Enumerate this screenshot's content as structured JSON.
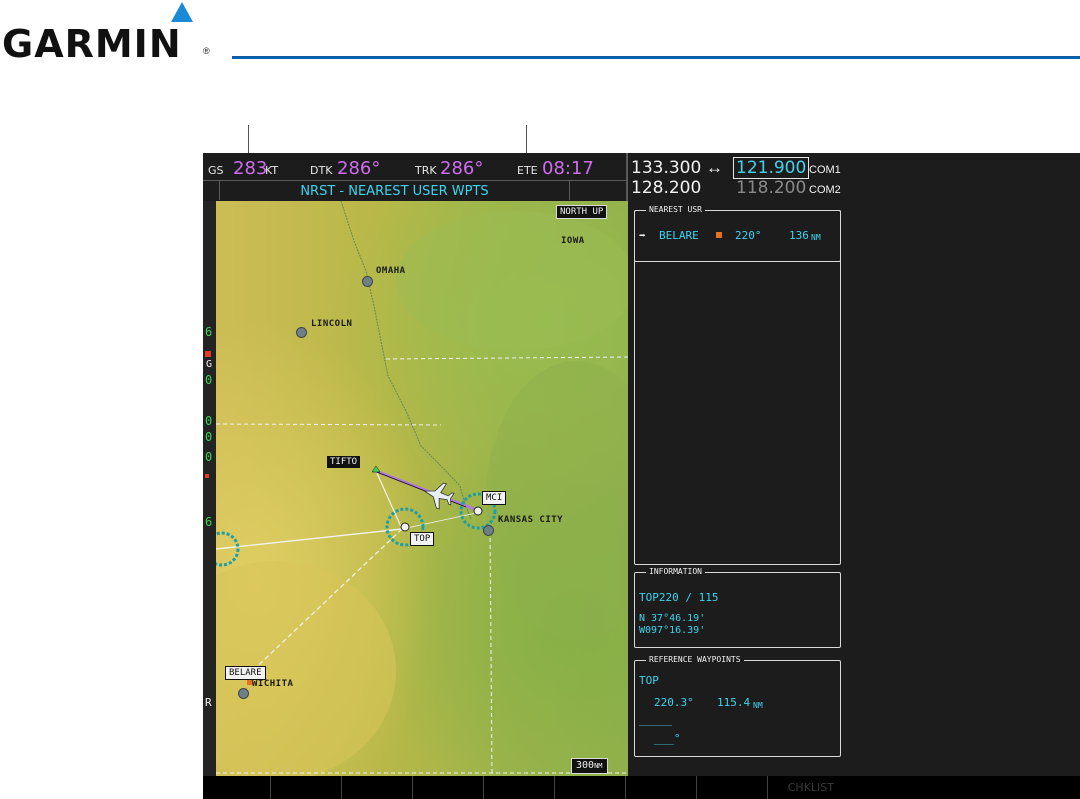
{
  "brand": {
    "name": "GARMIN",
    "registered_mark": "®"
  },
  "nav_bar": {
    "gs_label": "GS",
    "gs_value": "283",
    "gs_unit": "KT",
    "dtk_label": "DTK",
    "dtk_value": "286°",
    "trk_label": "TRK",
    "trk_value": "286°",
    "ete_label": "ETE",
    "ete_value": "08:17",
    "page_title": "NRST - NEAREST USER WPTS"
  },
  "radios": {
    "com1_active": "133.300",
    "com1_swap": "↔",
    "com1_standby": "121.900",
    "com1_label": "COM1",
    "com2_active": "128.200",
    "com2_standby": "118.200",
    "com2_label": "COM2"
  },
  "map": {
    "orientation": "NORTH UP",
    "range": "300",
    "range_unit": "NM",
    "labels": {
      "iowa": "IOWA",
      "omaha": "OMAHA",
      "lincoln": "LINCOLN",
      "kansas_city": "KANSAS CITY",
      "wichita": "WICHITA"
    },
    "waypoints": {
      "tifto": "TIFTO",
      "mci": "MCI",
      "top": "TOP",
      "belare": "BELARE"
    }
  },
  "left_strip": [
    "6",
    "G",
    "0",
    "0",
    "0",
    "0",
    "6",
    "R"
  ],
  "nearest_usr": {
    "title": "NEAREST USR",
    "rows": [
      {
        "name": "BELARE",
        "bearing": "220°",
        "distance": "136",
        "unit": "NM"
      }
    ]
  },
  "information": {
    "title": "INFORMATION",
    "name": "TOP220 / 115",
    "lat": "N 37°46.19'",
    "lon": "W097°16.39'"
  },
  "reference_waypoints": {
    "title": "REFERENCE WAYPOINTS",
    "ref1_name": "TOP",
    "ref1_bearing": "220.3°",
    "ref1_distance": "115.4",
    "ref1_unit": "NM",
    "ref2_name": "_____",
    "ref2_bearing": "___°"
  },
  "softkeys": {
    "chklist": "CHKLIST"
  },
  "colors": {
    "cyan": "#3ed4f0",
    "magenta": "#cf6df0",
    "garmin_blue": "#0a5fa6",
    "waypoint_orange": "#e8701e"
  }
}
